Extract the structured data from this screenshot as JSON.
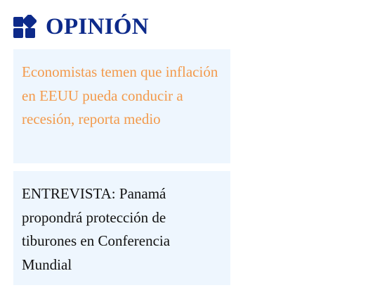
{
  "section": {
    "title": "OPINIÓN",
    "icon": "widgets-icon",
    "title_color": "#0d2a8a"
  },
  "articles": [
    {
      "headline": "Economistas temen que inflación en EEUU pueda conducir a recesión, reporta medio",
      "text_color": "#f39a4c"
    },
    {
      "headline": "ENTREVISTA: Panamá propondrá protección de tiburones en Conferencia Mundial",
      "text_color": "#111111"
    }
  ],
  "colors": {
    "card_background": "#eef6fe"
  }
}
